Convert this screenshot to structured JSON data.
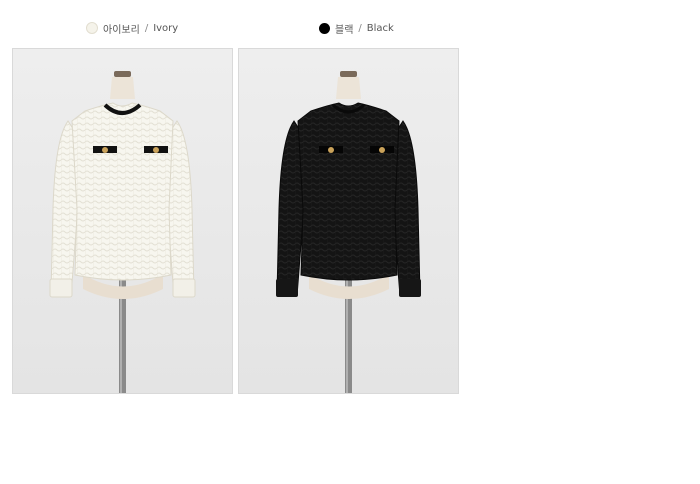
{
  "colors": {
    "ivory": {
      "label_ko": "아이보리",
      "separator": "/",
      "label_en": "Ivory",
      "swatch_hex": "#f5f3ea"
    },
    "black": {
      "label_ko": "블랙",
      "separator": "/",
      "label_en": "Black",
      "swatch_hex": "#000000"
    }
  },
  "photos": [
    {
      "subject": "ivory blouse on mannequin"
    },
    {
      "subject": "black blouse on mannequin"
    }
  ]
}
